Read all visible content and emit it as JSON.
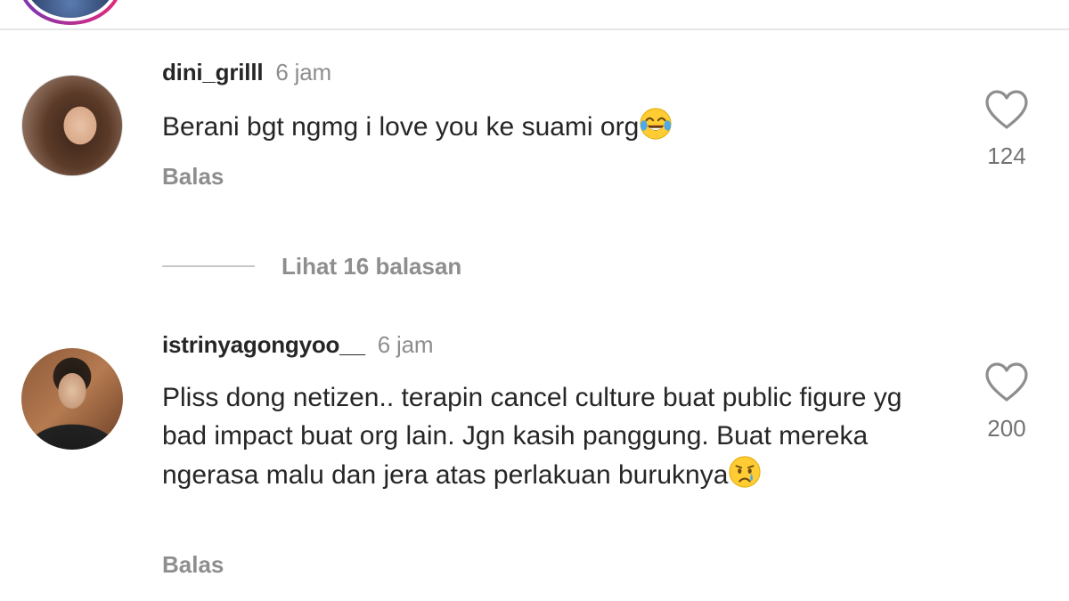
{
  "comments": [
    {
      "username": "dini_grilll",
      "time": "6 jam",
      "text": "Berani bgt ngmg i love you ke suami org",
      "emoji": "face-with-tears-of-joy",
      "likes": "124",
      "reply_label": "Balas"
    },
    {
      "username": "istrinyagongyoo__",
      "time": "6 jam",
      "text": "Pliss dong netizen.. terapin cancel culture buat public figure yg bad impact buat org lain. Jgn kasih panggung. Buat mereka ngerasa malu dan jera atas perlakuan buruknya",
      "emoji": "crying-face",
      "likes": "200",
      "reply_label": "Balas"
    }
  ],
  "view_replies_label": "Lihat 16 balasan",
  "colors": {
    "text_primary": "#262626",
    "text_secondary": "#8e8e8e",
    "divider": "#e6e6e6"
  }
}
